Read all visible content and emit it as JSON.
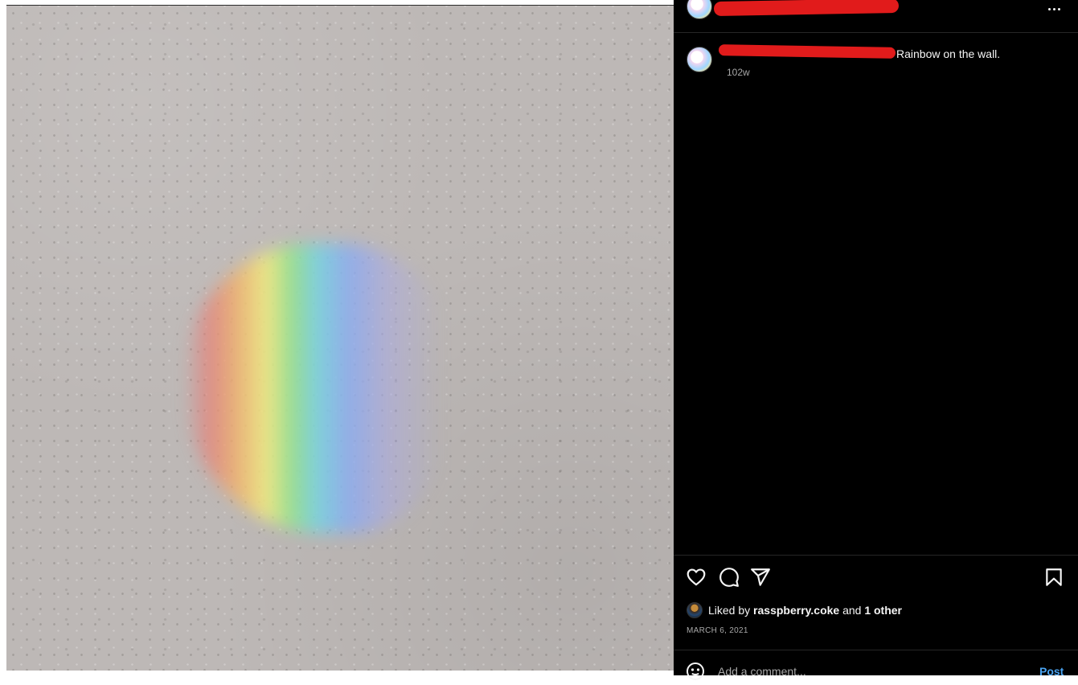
{
  "post": {
    "caption": "Rainbow on the wall.",
    "age": "102w",
    "date": "MARCH 6, 2021"
  },
  "likes": {
    "prefix": "Liked by",
    "user": "rasspberry.coke",
    "and": "and",
    "others": "1 other"
  },
  "comment": {
    "placeholder": "Add a comment...",
    "post_label": "Post"
  },
  "icons": {
    "more": "more-options-icon",
    "like": "heart-icon",
    "comment": "comment-icon",
    "share": "share-icon",
    "save": "bookmark-icon",
    "emoji": "emoji-icon"
  },
  "colors": {
    "panel_bg": "#000000",
    "text": "#f5f5f5",
    "muted": "#a8a8a8",
    "link": "#4aa3f0",
    "redaction": "#e11b1b"
  }
}
